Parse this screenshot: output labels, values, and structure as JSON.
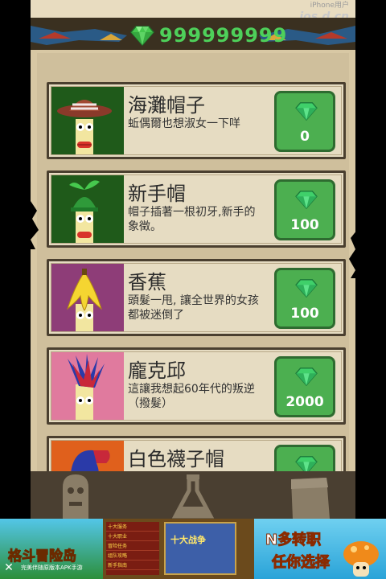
{
  "header": {
    "gem_count": "999999999",
    "gem_icon": "green-gem-icon",
    "colors": {
      "gem": "#4ed05a",
      "bar": "#3a3020"
    }
  },
  "watermark": {
    "line1": "iPhone用户",
    "site": "ios.d.cn"
  },
  "shop_items": [
    {
      "title": "海灘帽子",
      "desc": "蚯偶爾也想淑女一下咩",
      "price": "0",
      "bg": "#1f5a1a",
      "hat": "striped-sun-hat"
    },
    {
      "title": "新手帽",
      "desc": "帽子插著一根初牙,新手的象徵。",
      "price": "100",
      "bg": "#1f5a1a",
      "hat": "sprout-cap"
    },
    {
      "title": "香蕉",
      "desc": "頭髮一甩, 讓全世界的女孩都被迷倒了",
      "price": "100",
      "bg": "#8e3d78",
      "hat": "banana-peel"
    },
    {
      "title": "龐克邱",
      "desc": "這讓我想起60年代的叛逆（撥髮）",
      "price": "2000",
      "bg": "#e07a9e",
      "hat": "punk-mohawk"
    },
    {
      "title": "白色襪子帽",
      "desc": "",
      "price": "",
      "bg": "#e0601c",
      "hat": "sock-hat"
    }
  ],
  "bottom_tabs": [
    {
      "name": "character-tab",
      "icon": "stone-head-icon"
    },
    {
      "name": "lab-tab",
      "icon": "flask-icon"
    },
    {
      "name": "relic-tab",
      "icon": "stone-block-icon"
    }
  ],
  "ad": {
    "left_title": "格斗冒险岛",
    "left_sub": "完美伴随原版本APK手游",
    "menu": [
      "十大服务",
      "十大职业",
      "冒险任务",
      "组队攻略",
      "新手指南"
    ],
    "screen_title": "十大战争",
    "right_line1": "N多转职",
    "right_line2": "任你选择",
    "close": "✕"
  }
}
